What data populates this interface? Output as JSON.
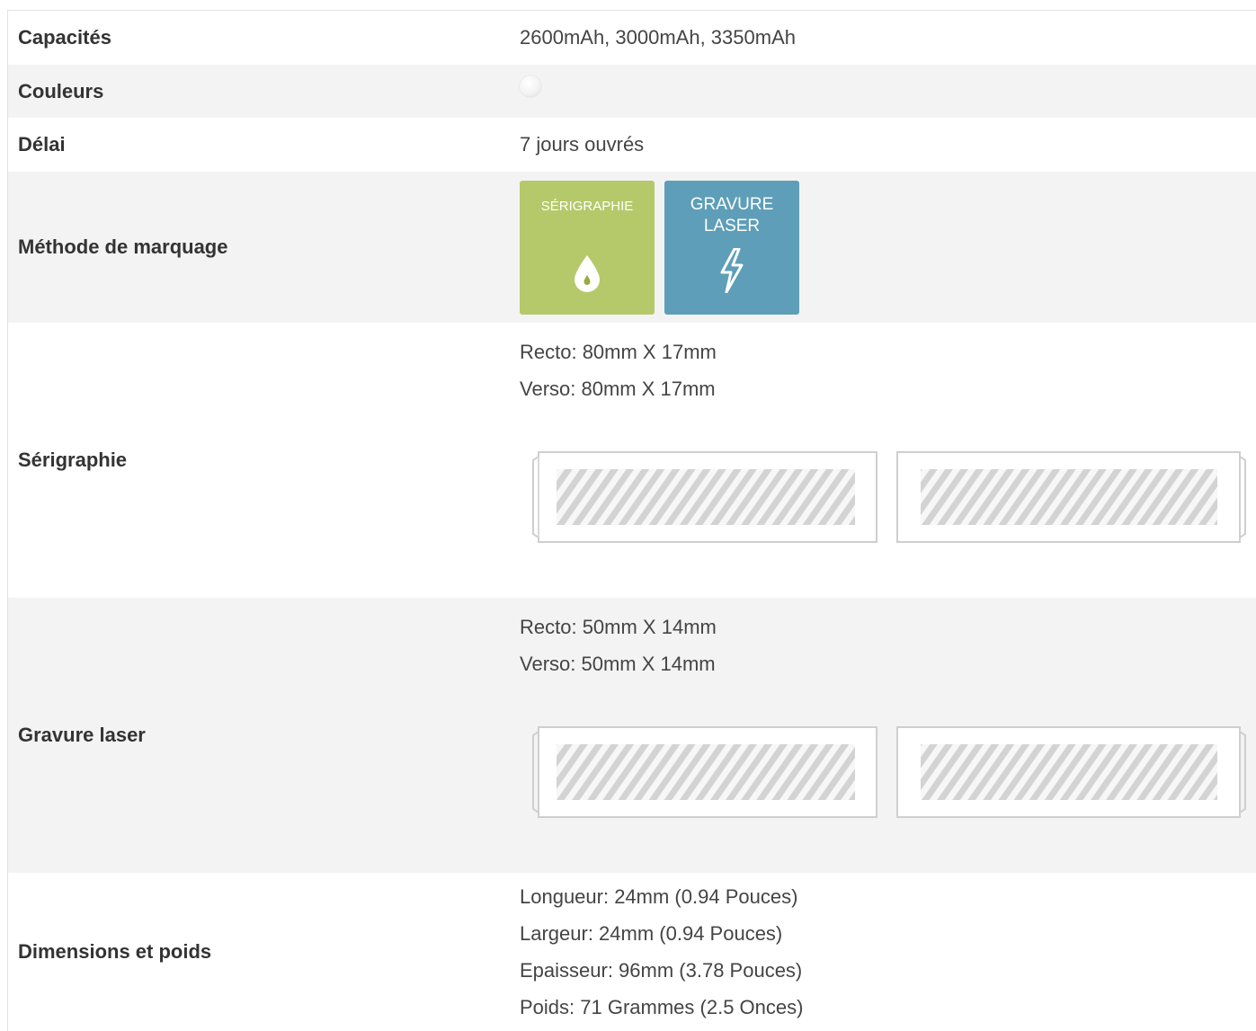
{
  "specs": {
    "capacities": {
      "label": "Capacités",
      "value": "2600mAh, 3000mAh, 3350mAh"
    },
    "colors": {
      "label": "Couleurs",
      "swatches": [
        "#f3f3f3"
      ]
    },
    "delay": {
      "label": "Délai",
      "value": "7 jours ouvrés"
    },
    "marking": {
      "label": "Méthode de marquage",
      "methods": [
        {
          "name": "SÉRIGRAPHIE",
          "icon": "drop-icon",
          "color": "#b5c96a"
        },
        {
          "name": "GRAVURE LASER",
          "icon": "lightning-icon",
          "color": "#5e9eb8"
        }
      ]
    },
    "screen_print": {
      "label": "Sérigraphie",
      "recto": "Recto: 80mm X 17mm",
      "verso": "Verso: 80mm X 17mm"
    },
    "laser": {
      "label": "Gravure laser",
      "recto": "Recto: 50mm X 14mm",
      "verso": "Verso: 50mm X 14mm"
    },
    "dimensions": {
      "label": "Dimensions et poids",
      "length": "Longueur: 24mm (0.94 Pouces)",
      "width": "Largeur: 24mm (0.94 Pouces)",
      "thickness": "Epaisseur: 96mm (3.78 Pouces)",
      "weight": "Poids: 71 Grammes (2.5 Onces)"
    }
  }
}
